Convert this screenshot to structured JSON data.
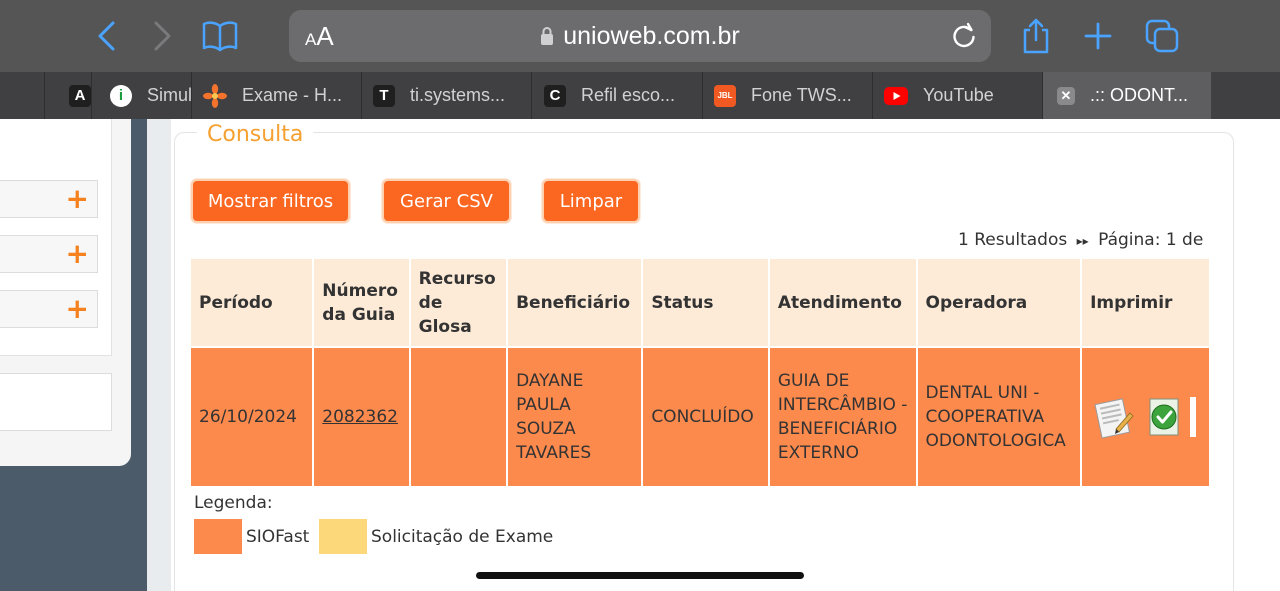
{
  "browser": {
    "url_text": "unioweb.com.br",
    "aa_label_small": "A",
    "aa_label_large": "A",
    "tabs": [
      {
        "favicon_text": "A",
        "title": "",
        "favicon_bg": "#1f1f1f"
      },
      {
        "favicon_text": "i",
        "title": "Simul",
        "favicon_bg": "#1a9c3e"
      },
      {
        "favicon_text": "",
        "title": "Exame - H...",
        "favicon_icon": "flower-icon"
      },
      {
        "favicon_text": "T",
        "title": "ti.systems...",
        "favicon_bg": "#1f1f1f"
      },
      {
        "favicon_text": "C",
        "title": "Refil esco...",
        "favicon_bg": "#1f1f1f"
      },
      {
        "favicon_text": "JBL",
        "title": "Fone TWS...",
        "favicon_bg": "#f05a22"
      },
      {
        "favicon_text": "",
        "title": "YouTube",
        "favicon_icon": "youtube-icon"
      },
      {
        "favicon_text": "✕",
        "title": ".:: ODONT...",
        "favicon_bg": "#8a8a8c"
      }
    ]
  },
  "consulta": {
    "legend": "Consulta",
    "buttons": {
      "mostrar_filtros": "Mostrar filtros",
      "gerar_csv": "Gerar CSV",
      "limpar": "Limpar"
    },
    "results_count": "1 Resultados",
    "results_arrow": "▸▸",
    "pagination": "Página: 1 de",
    "table": {
      "headers": [
        "Período",
        "Número da Guia",
        "Recurso de Glosa",
        "Beneficiário",
        "Status",
        "Atendimento",
        "Operadora",
        "Imprimir"
      ],
      "rows": [
        {
          "periodo": "26/10/2024",
          "numero_guia": "2082362",
          "recurso_glosa": "",
          "beneficiario": "DAYANE PAULA SOUZA TAVARES",
          "status": "CONCLUÍDO",
          "atendimento": "GUIA DE INTERCÂMBIO - BENEFICIÁRIO EXTERNO",
          "operadora": "DENTAL UNI - COOPERATIVA ODONTOLOGICA"
        }
      ]
    },
    "legenda": {
      "label": "Legenda:",
      "items": [
        {
          "label": "SIOFast",
          "color": "#fd8a4d"
        },
        {
          "label": "Solicitação de Exame",
          "color": "#fcd87a"
        }
      ]
    }
  },
  "colors": {
    "accent_orange": "#fb6620",
    "legend_orange": "#f5a030",
    "header_bg": "#fdebd8",
    "row_bg": "#fd8a4d",
    "sidebar_plus": "#f5821f"
  }
}
